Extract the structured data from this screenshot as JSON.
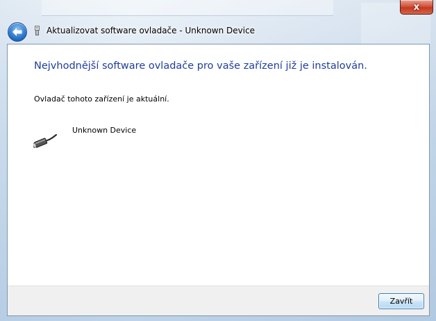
{
  "window": {
    "title": "Aktualizovat software ovladače - Unknown Device",
    "close_glyph": "x",
    "back_icon": "back-arrow-icon",
    "title_icon": "usb-plug-icon"
  },
  "content": {
    "heading": "Nejvhodnější software ovladače pro vaše zařízení již je instalován.",
    "status": "Ovladač tohoto zařízení je aktuální.",
    "device_name": "Unknown Device",
    "device_icon": "usb-cable-icon"
  },
  "footer": {
    "close_label": "Zavřít"
  },
  "colors": {
    "heading": "#1e3e9a",
    "close_button": "#c23a1f",
    "accent": "#3c7fb1"
  }
}
